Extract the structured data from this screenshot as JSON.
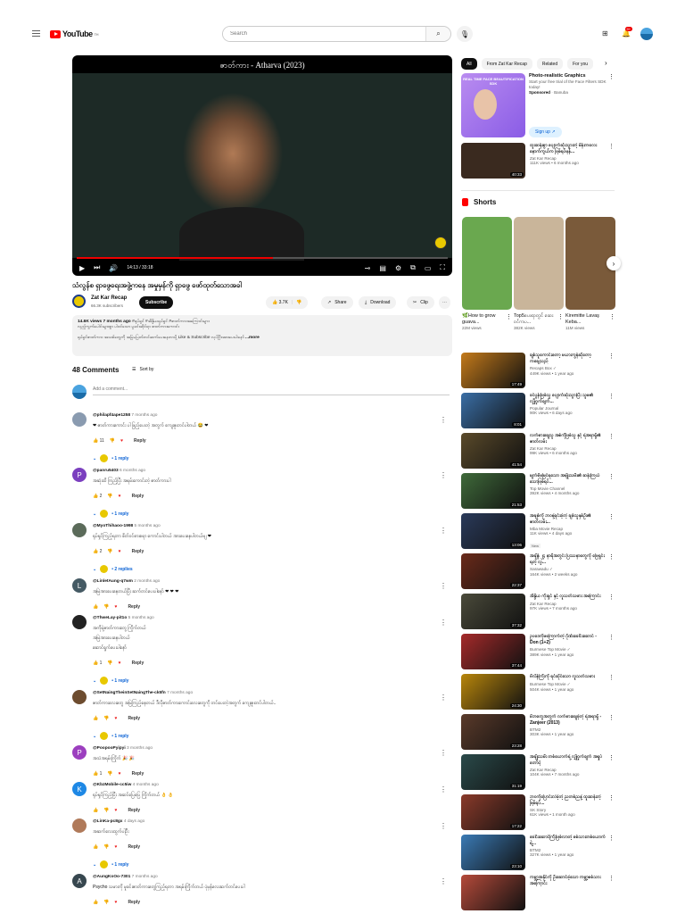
{
  "header": {
    "logo": "YouTube",
    "logo_sup": "TH",
    "search_placeholder": "Search",
    "notif_count": "9+"
  },
  "player": {
    "caption": "ဇာတ်ကား - Atharva (2023)",
    "time": "14:13 / 33:18",
    "progress": 0.53,
    "buffered": 0.57
  },
  "video": {
    "title": "သံလွန်စ ရှာဖွေရေးအဖွဲ့ကနေ အမှုမှန်ကို ရှာဖွေ ဖော်ထုတ်သောအခါ",
    "channel": "Zat Kar Recap",
    "subscribers": "66.3K subscribers",
    "subscribe": "Subscribe",
    "likes": "3.7K",
    "share": "Share",
    "download": "Download",
    "clip": "Clip"
  },
  "description": {
    "stats": "14.6K views  7 months ago",
    "tags": "#ရုပ်ရှင် #အိန္ဒိယရုပ်ရှင် #ဇာတ်ကားအကြောင်းများ",
    "line2": "လှည့်ကွက်ပေါင်းများစွာ ပါဝင်သော မှုခင်းဆိုင်ရာ ဇာတ်ကားကောင်း",
    "line3": "ရုပ်ရှင်ဇာတ်ကား အသစ်တွေကို အမြဲမပြတ်တင်ဆက်ပေးနေတာမို့ Like & Subscribe လုပ်ပြီးအားပေးပါနော်",
    "more": "...more"
  },
  "comments_header": {
    "count": "48 Comments",
    "sort": "Sort by",
    "add_placeholder": "Add a comment..."
  },
  "comments": [
    {
      "user": "@philapf4ape1258",
      "time": "7 months ago",
      "text": "❤ ဇာတ်ကားကောင်း ပါ ဖြည့်ပေးတဲ့ အတွက် ကျေးဇူးတင်ပါတယ် 😂 ❤",
      "likes": "11",
      "replies": "1 reply",
      "initial": "",
      "color": "#8a9bb0"
    },
    {
      "user": "@panru5403",
      "time": "6 months ago",
      "text": "အဆုံးထိ ကြည့်ပြီး အရမ်းကောင်းတဲ့ ဇာတ်ကားပါ",
      "likes": "2",
      "replies": "1 reply",
      "initial": "P",
      "color": "#7b3fbf"
    },
    {
      "user": "@MyoThihaoo-1998",
      "time": "5 months ago",
      "text": "ရုပ်ရှင်ကြည့်ရတာ စိတ်ဝင်စားစရာ ကောင်းပါတယ် အားပေးနေပါတယ်ဗျ ❤",
      "likes": "2",
      "replies": "2 replies",
      "initial": "",
      "color": "#5b6b5a"
    },
    {
      "user": "@LinletAung-q7wm",
      "time": "2 months ago",
      "text": "အမြဲအားပေးနေတယ်ပြီး ဆက်တင်ပေးပါနော် ❤ ❤ ❤",
      "likes": "",
      "replies": "",
      "initial": "L",
      "color": "#455a64"
    },
    {
      "user": "@ThweLay-pit1o",
      "time": "5 months ago",
      "text": "အကိုရဲ့ဇာတ်ကားတွေ ကြိုက်တယ်\nအမြဲအားပေးနေပါတယ်\nဆောင်ရွက်ပေးပါနော်",
      "likes": "1",
      "replies": "1 reply",
      "initial": "",
      "color": "#222"
    },
    {
      "user": "@SetNaingTheinSetNaingThe-ck5fn",
      "time": "7 months ago",
      "text": "ဇာတ်ကားလေးတွေ အမြဲကြည့်နေတယ် ဒီလိုဇာတ်ကားကောင်းလေးတွေကို တင်ပေးတဲ့အတွက် ကျေးဇူးတင်ပါတယ်..",
      "likes": "",
      "replies": "1 reply",
      "initial": "",
      "color": "#6d4c2f"
    },
    {
      "user": "@PoopooPyipyi",
      "time": "3 months ago",
      "text": "အသံအရမ်းကြိုက် 🎉 🎉",
      "likes": "1",
      "replies": "",
      "initial": "P",
      "color": "#9c3fbf"
    },
    {
      "user": "@KbzMobile-cc5iw",
      "time": "4 months ago",
      "text": "ရုပ်ရှင်ကြည့်ပြီး အဆင်ပြေပြေ ကြိုက်တယ် 👌 👌",
      "likes": "",
      "replies": "",
      "initial": "K",
      "color": "#1e88e5"
    },
    {
      "user": "@LinKa-pc8gx",
      "time": "4 days ago",
      "text": "အဆက်လေးထွက်ပါဦး",
      "likes": "",
      "replies": "1 reply",
      "initial": "",
      "color": "#b07a5a"
    },
    {
      "user": "@AungKoOo-7301",
      "time": "7 months ago",
      "text": "Psycho သမားကို မှုခင်းဇာတ်ကားတွေကြည့်ရတာ အရမ်းကြိုက်တယ် ပုံမှန်လေးဆက်တင်ပေးပါ",
      "likes": "",
      "replies": "",
      "initial": "A",
      "color": "#37474f"
    }
  ],
  "comment_actions": {
    "reply": "Reply"
  },
  "chips": [
    "All",
    "From Zat Kar Recap",
    "Related",
    "For you"
  ],
  "ad": {
    "image_text": "REAL TIME FACE BEAUTIFICATION SDK",
    "title": "Photo-realistic Graphics",
    "desc": "Start your free trial of the Face Filters SDK today!",
    "sponsored": "Sponsored",
    "advertiser": "Banuba",
    "cta": "Sign up"
  },
  "first_video": {
    "title": "ထူးဆန်းစွာ ပျောက်ဆုံးသွားတဲ့ မိန်းကလေး နောက်ကွယ်က ဖြစ်ရပ်မှန်...",
    "channel": "Zat Kar Recap",
    "meta": "111K views • 6 months ago",
    "duration": "40:33",
    "color": "#3a2a1f"
  },
  "shorts": {
    "title": "Shorts",
    "items": [
      {
        "title": "🌿How to grow guava...",
        "views": "22M views",
        "color": "#6aa84f"
      },
      {
        "title": "Top5ပေးရာတွင် ဆေးဝင်ကပ...",
        "views": "382K views",
        "color": "#c9b59a"
      },
      {
        "title": "Kiremitte Lavaş Keba...",
        "views": "11M views",
        "color": "#7a5a3a"
      }
    ]
  },
  "related": [
    {
      "title": "ချစ်သူကောင်းတော့ မယားကွန်ဆိုတော့ ကချေသည်",
      "channel": "Recaps Box ✓",
      "meta": "449K views • 1 year ago",
      "duration": "17:49",
      "color": "#c47a1a"
    },
    {
      "title": "ခင်ပွန်းဖြစ်သူ ပျောက်ဆုံးသွားပြီး သူမ၏ လျှို့ဝှက်ချက်...",
      "channel": "Popular Journal",
      "meta": "90K views • 6 days ago",
      "duration": "8:01",
      "color": "#3a6ea5"
    },
    {
      "title": "လက်စားချေသူ အစ်ကိုဖြစ်သူ နှင့် ရဲအရာရှိ၏ ဇာတ်လမ်း",
      "channel": "Zat Kar Recap",
      "meta": "99K views • 6 months ago",
      "duration": "41:54",
      "color": "#5a4a2a"
    },
    {
      "title": "မျက်စိမမြင်ရသော အမျိုးသမီး၏ ဆန်းကြယ်သောဖြစ်ရပ်...",
      "channel": "Top Movie Channel",
      "meta": "392K views • 4 months ago",
      "duration": "21:53",
      "color": "#3f6a3a"
    },
    {
      "title": "အချစ်ကို ဘဝနဲ့ရင်းခဲ့တဲ့ ချစ်သူနှစ်ဦး၏ ဇာတ်လမ်း...",
      "channel": "Mba Movie Recap",
      "meta": "11K views • 4 days ago",
      "badge": "New",
      "duration": "13:06",
      "color": "#2a3a5a"
    },
    {
      "title": "အချိန် ၂၄ နာရီအတွင်း ပြဿနာတွေကို ဖြေရှင်းရတဲ့ လူ...",
      "channel": "Sarawadu ✓",
      "meta": "164K views • 2 weeks ago",
      "duration": "22:37",
      "color": "#6a2a1a"
    },
    {
      "title": "အိန္ဒိယ ကိုးရှင် နှင့် လူသတ်သမား အကြောင်း",
      "channel": "Zat Kar Recap",
      "meta": "97K views • 7 months ago",
      "duration": "37:32",
      "color": "#4a4a3a"
    },
    {
      "title": "ဥပဒေကိုမကြောက်တဲ့ ဂိုဏ်းခေါင်းဆောင် - Don (1+2)",
      "channel": "Burmese Top Movie ✓",
      "meta": "389K views • 1 year ago",
      "duration": "37:44",
      "color": "#a52a2a"
    },
    {
      "title": "ဗီလိန်ကြီးကို ရင်ဆိုင်သော လူသတ်သမား",
      "channel": "Burmese Top Movie ✓",
      "meta": "504K views • 1 year ago",
      "duration": "24:30",
      "color": "#b8860b"
    },
    {
      "title": "မိဘတွေအတွက် လက်စားချေခဲ့တဲ့ ရဲအရာရှိ - Zanjeer (2013)",
      "channel": "BTM2",
      "meta": "303K views • 1 year ago",
      "duration": "23:28",
      "color": "#5a3a2a"
    },
    {
      "title": "အချိုးသမီး တစ်ယောက်ရဲ့ လျှို့ဝှက်ချက် အရှုပ်တော်ပုံ",
      "channel": "Zat Kar Recap",
      "meta": "104K views • 7 months ago",
      "duration": "31:19",
      "color": "#2a4a4a"
    },
    {
      "title": "ဘဝကိုပြောင်းလဲခဲ့တဲ့ ညတစ်ညနဲ့ ထူးဆန်းတဲ့ ဖြစ်ရပ်...",
      "channel": "SK Story",
      "meta": "61K views • 1 month ago",
      "duration": "17:22",
      "color": "#8a3a2a"
    },
    {
      "title": "ခေါင်းဆောင်ကြီးဖြစ်လာတဲ့ စစ်သားတစ်ယောက်ရဲ့...",
      "channel": "BTM2",
      "meta": "327K views • 1 year ago",
      "duration": "23:10",
      "color": "#3a7ab5"
    },
    {
      "title": "ကမ္ဘာ့အနိုင်ကို ဦးဆောင်ခဲ့သော ကမ္ဘာ့စစ်သားအကြောင်း",
      "channel": "",
      "meta": "",
      "duration": "",
      "color": "#b54a3a"
    }
  ]
}
